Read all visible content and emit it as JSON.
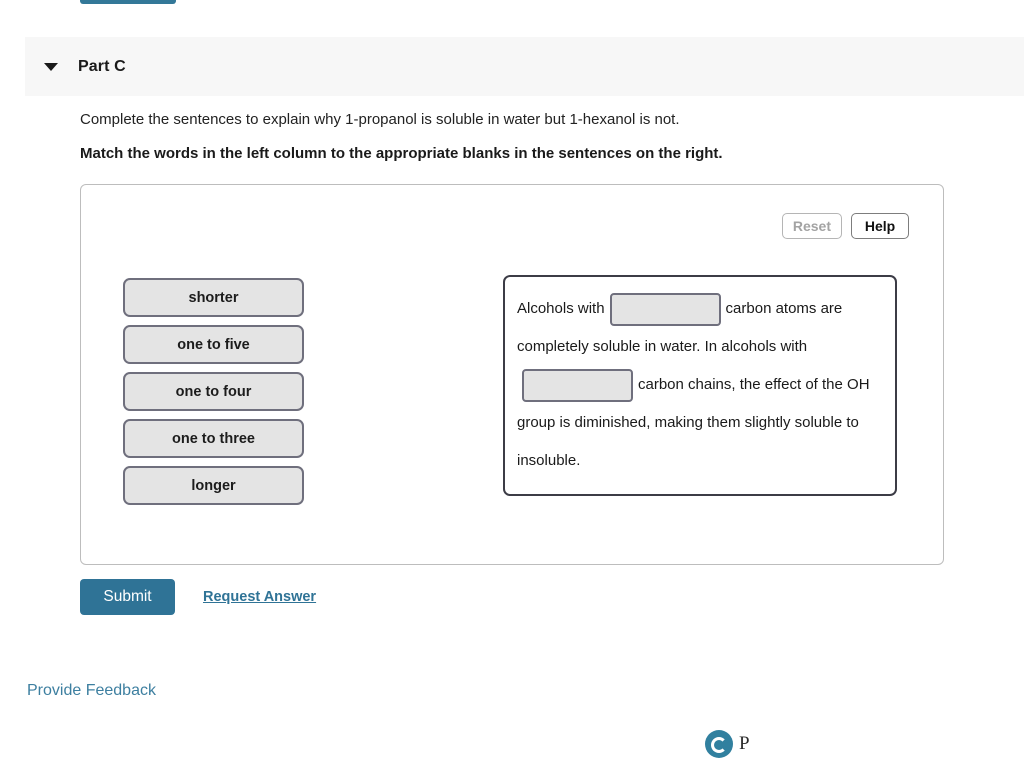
{
  "top_partial_button": {
    "label": "",
    "color": "#337898"
  },
  "part": {
    "toggle_icon": "caret-down-icon",
    "title": "Part C"
  },
  "question": {
    "prompt": "Complete the sentences to explain why 1-propanol is soluble in water but 1-hexanol is not.",
    "instruction": "Match the words in the left column to the appropriate blanks in the sentences on the right."
  },
  "tools": {
    "reset_label": "Reset",
    "reset_enabled": false,
    "help_label": "Help",
    "help_enabled": true
  },
  "word_bank": {
    "items": [
      {
        "label": "shorter"
      },
      {
        "label": "one to five"
      },
      {
        "label": "one to four"
      },
      {
        "label": "one to three"
      },
      {
        "label": "longer"
      }
    ]
  },
  "sentence": {
    "fragments": [
      {
        "type": "text",
        "value": "Alcohols with"
      },
      {
        "type": "blank",
        "value": ""
      },
      {
        "type": "text",
        "value": "carbon atoms are completely soluble in water. In alcohols with"
      },
      {
        "type": "blank",
        "value": ""
      },
      {
        "type": "text",
        "value": "carbon chains, the effect of the OH group is diminished, making them slightly soluble to insoluble."
      }
    ],
    "frag_1": "Alcohols with",
    "frag_2": "carbon atoms are completely soluble in water. In alcohols with",
    "frag_3": "carbon chains, the effect of the OH group is diminished, making them slightly soluble to insoluble."
  },
  "actions": {
    "submit_label": "Submit",
    "request_answer_label": "Request Answer"
  },
  "footer": {
    "provide_feedback_label": "Provide Feedback",
    "logo_icon": "pearson-logo-icon",
    "logo_text": "P"
  },
  "colors": {
    "accent": "#2f7396",
    "header_bg": "#f7f7f7",
    "tile_fill": "#e4e4e4",
    "tile_border": "#6f6f7d"
  }
}
